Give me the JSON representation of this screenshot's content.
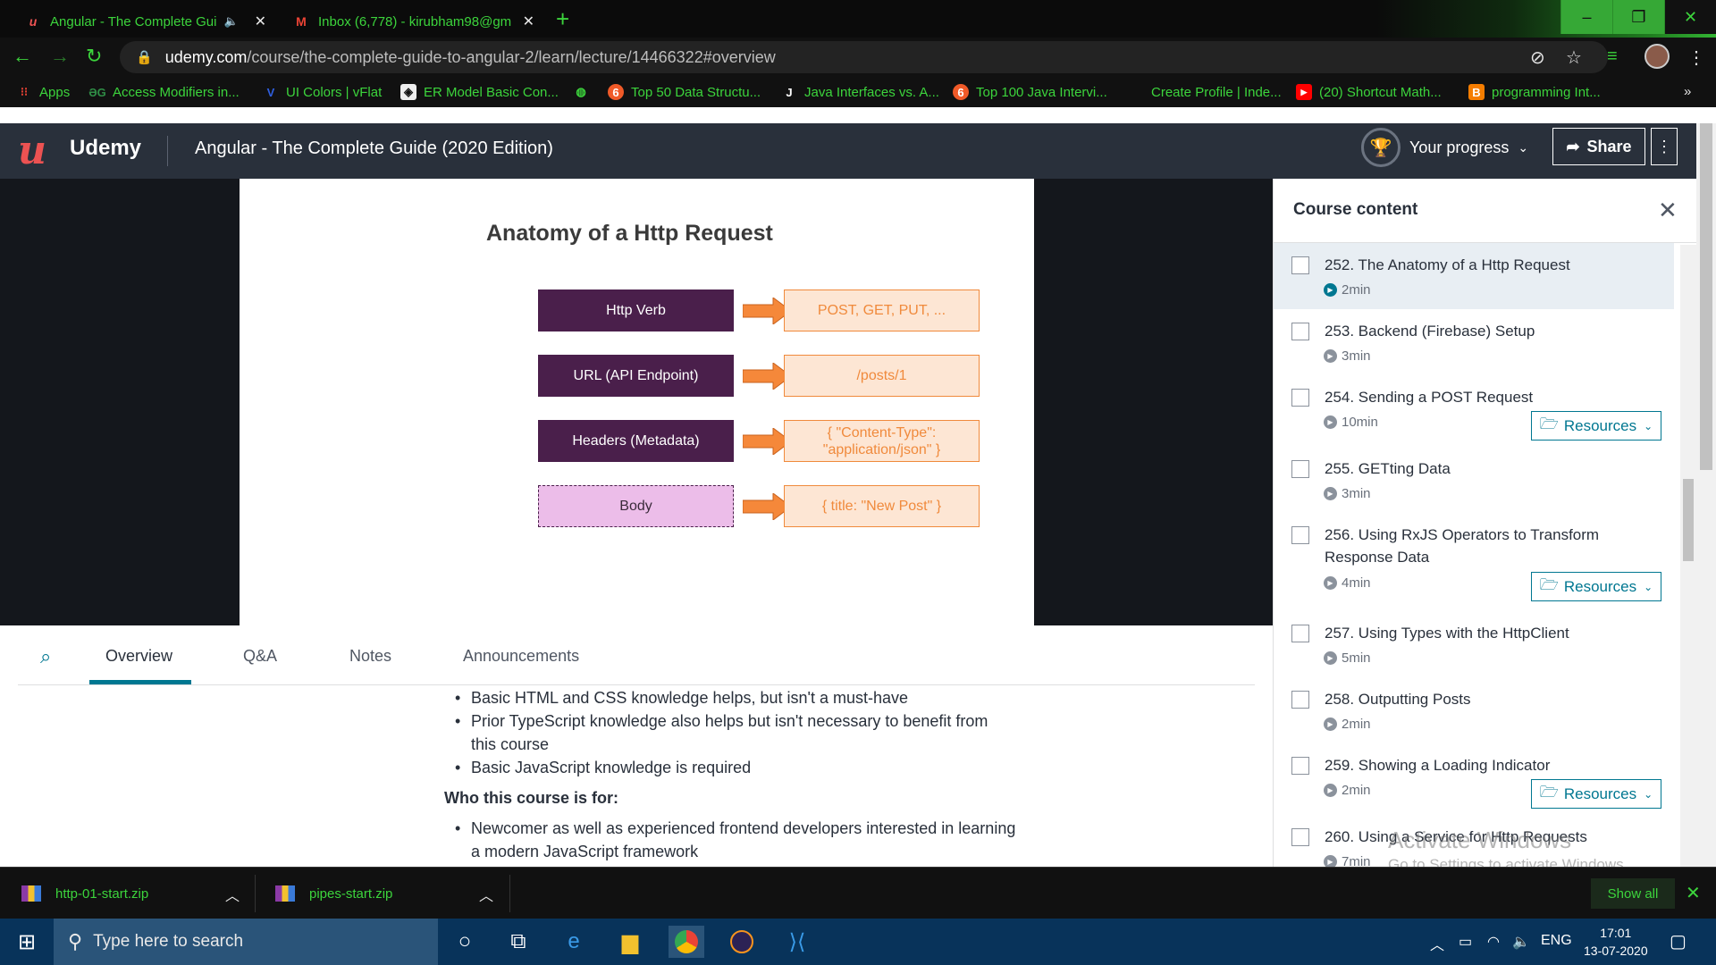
{
  "browser": {
    "tabs": [
      {
        "title": "Angular - The Complete Gui",
        "favicon": "udemy-icon",
        "audio": true
      },
      {
        "title": "Inbox (6,778) - kirubham98@gm",
        "favicon": "gmail-icon"
      }
    ],
    "new_tab": "+",
    "window_buttons": [
      "–",
      "❐",
      "✕"
    ],
    "url_host": "udemy.com",
    "url_path": "/course/the-complete-guide-to-angular-2/learn/lecture/14466322#overview",
    "bookmarks": [
      {
        "label": "Apps",
        "icon": "apps-grid-icon"
      },
      {
        "label": "Access Modifiers in...",
        "icon": "geeksforgeeks-icon"
      },
      {
        "label": "UI Colors | vFlat",
        "icon": "vflat-icon"
      },
      {
        "label": "ER Model Basic Con...",
        "icon": "er-model-icon"
      },
      {
        "label": "",
        "icon": "globe-icon"
      },
      {
        "label": "Top 50 Data Structu...",
        "icon": "bookmark-orange-icon"
      },
      {
        "label": "Java Interfaces vs. A...",
        "icon": "j-icon"
      },
      {
        "label": "Top 100 Java Intervi...",
        "icon": "bookmark-orange-icon"
      },
      {
        "label": "Create Profile | Inde...",
        "icon": "indeed-icon"
      },
      {
        "label": "(20) Shortcut Math...",
        "icon": "youtube-icon"
      },
      {
        "label": "programming Int...",
        "icon": "blogger-icon"
      }
    ],
    "bookmarks_overflow": "»"
  },
  "udemy": {
    "brand": "Udemy",
    "course_title": "Angular - The Complete Guide (2020 Edition)",
    "progress_label": "Your progress",
    "share_label": "Share"
  },
  "slide": {
    "title": "Anatomy of a Http Request",
    "rows": [
      {
        "left": "Http Verb",
        "right": "POST, GET, PUT, ..."
      },
      {
        "left": "URL (API Endpoint)",
        "right": "/posts/1"
      },
      {
        "left": "Headers (Metadata)",
        "right": "{ \"Content-Type\": \"application/json\" }"
      },
      {
        "left": "Body",
        "right": "{ title: \"New Post\" }"
      }
    ]
  },
  "content_tabs": [
    "Overview",
    "Q&A",
    "Notes",
    "Announcements"
  ],
  "description": {
    "bullets_1": [
      "Basic HTML and CSS knowledge helps, but isn't a must-have",
      "Prior TypeScript knowledge also helps but isn't necessary to benefit from this course",
      "Basic JavaScript knowledge is required"
    ],
    "audience_heading": "Who this course is for:",
    "bullets_2": [
      "Newcomer as well as experienced frontend developers interested in learning a modern JavaScript framework"
    ]
  },
  "sidebar": {
    "title": "Course content",
    "lessons": [
      {
        "title": "252. The Anatomy of a Http Request",
        "duration": "2min",
        "resources": false,
        "active": true
      },
      {
        "title": "253. Backend (Firebase) Setup",
        "duration": "3min",
        "resources": false
      },
      {
        "title": "254. Sending a POST Request",
        "duration": "10min",
        "resources": true
      },
      {
        "title": "255. GETting Data",
        "duration": "3min",
        "resources": false
      },
      {
        "title": "256. Using RxJS Operators to Transform Response Data",
        "duration": "4min",
        "resources": true
      },
      {
        "title": "257. Using Types with the HttpClient",
        "duration": "5min",
        "resources": false
      },
      {
        "title": "258. Outputting Posts",
        "duration": "2min",
        "resources": false
      },
      {
        "title": "259. Showing a Loading Indicator",
        "duration": "2min",
        "resources": true
      },
      {
        "title": "260. Using a Service for Http Requests",
        "duration": "7min",
        "resources": false
      }
    ],
    "resources_label": "Resources"
  },
  "watermark": {
    "line1": "Activate Windows",
    "line2": "Go to Settings to activate Windows."
  },
  "downloads": {
    "items": [
      "http-01-start.zip",
      "pipes-start.zip"
    ],
    "show_all": "Show all"
  },
  "taskbar": {
    "search_placeholder": "Type here to search",
    "language": "ENG",
    "time": "17:01",
    "date": "13-07-2020"
  }
}
